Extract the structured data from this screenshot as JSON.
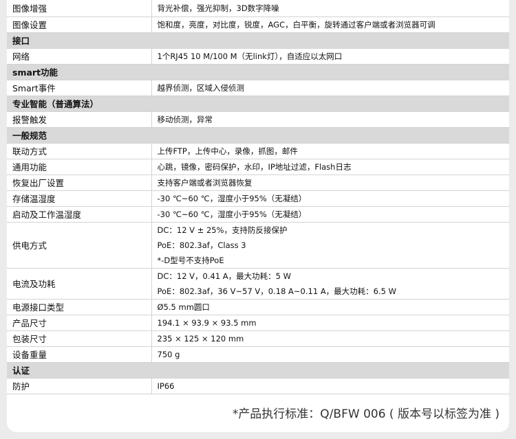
{
  "rows": [
    {
      "type": "row",
      "key": "图像增强",
      "values": [
        "背光补偿，强光抑制，3D数字降噪"
      ]
    },
    {
      "type": "row",
      "key": "图像设置",
      "values": [
        "饱和度，亮度，对比度，锐度，AGC，白平衡，旋转通过客户端或者浏览器可调"
      ]
    },
    {
      "type": "section",
      "key": "接口"
    },
    {
      "type": "row",
      "key": "网络",
      "values": [
        "1个RJ45 10 M/100 M（无link灯），自适应以太网口"
      ]
    },
    {
      "type": "section",
      "key": "smart功能"
    },
    {
      "type": "row",
      "key": "Smart事件",
      "values": [
        "越界侦测，区域入侵侦测"
      ]
    },
    {
      "type": "section",
      "key": "专业智能（普通算法）"
    },
    {
      "type": "row",
      "key": "报警触发",
      "values": [
        "移动侦测，异常"
      ]
    },
    {
      "type": "section",
      "key": "一般规范"
    },
    {
      "type": "row",
      "key": "联动方式",
      "values": [
        "上传FTP，上传中心，录像，抓图，邮件"
      ]
    },
    {
      "type": "row",
      "key": "通用功能",
      "values": [
        "心跳，镜像，密码保护，水印，IP地址过滤，Flash日志"
      ]
    },
    {
      "type": "row",
      "key": "恢复出厂设置",
      "values": [
        "支持客户端或者浏览器恢复"
      ]
    },
    {
      "type": "row",
      "key": "存储温湿度",
      "values": [
        "-30 ℃~60 ℃，湿度小于95%（无凝结）"
      ]
    },
    {
      "type": "row",
      "key": "启动及工作温湿度",
      "values": [
        "-30 ℃~60 ℃，湿度小于95%（无凝结）"
      ]
    },
    {
      "type": "row",
      "key": "供电方式",
      "values": [
        "DC：12 V ± 25%，支持防反接保护",
        "PoE：802.3af，Class 3",
        "*-D型号不支持PoE"
      ]
    },
    {
      "type": "row",
      "key": "电流及功耗",
      "values": [
        "DC：12 V，0.41 A，最大功耗：5 W",
        "PoE：802.3af，36 V~57 V，0.18 A~0.11 A，最大功耗：6.5 W"
      ]
    },
    {
      "type": "row",
      "key": "电源接口类型",
      "values": [
        "Ø5.5 mm圆口"
      ]
    },
    {
      "type": "row",
      "key": "产品尺寸",
      "values": [
        "194.1 × 93.9 × 93.5 mm"
      ]
    },
    {
      "type": "row",
      "key": "包装尺寸",
      "values": [
        "235 × 125 × 120 mm"
      ]
    },
    {
      "type": "row",
      "key": "设备重量",
      "values": [
        "750 g"
      ]
    },
    {
      "type": "section",
      "key": "认证"
    },
    {
      "type": "row",
      "key": "防护",
      "values": [
        "IP66"
      ]
    }
  ],
  "footnote": "*产品执行标准：Q/BFW 006 ( 版本号以标签为准 )"
}
